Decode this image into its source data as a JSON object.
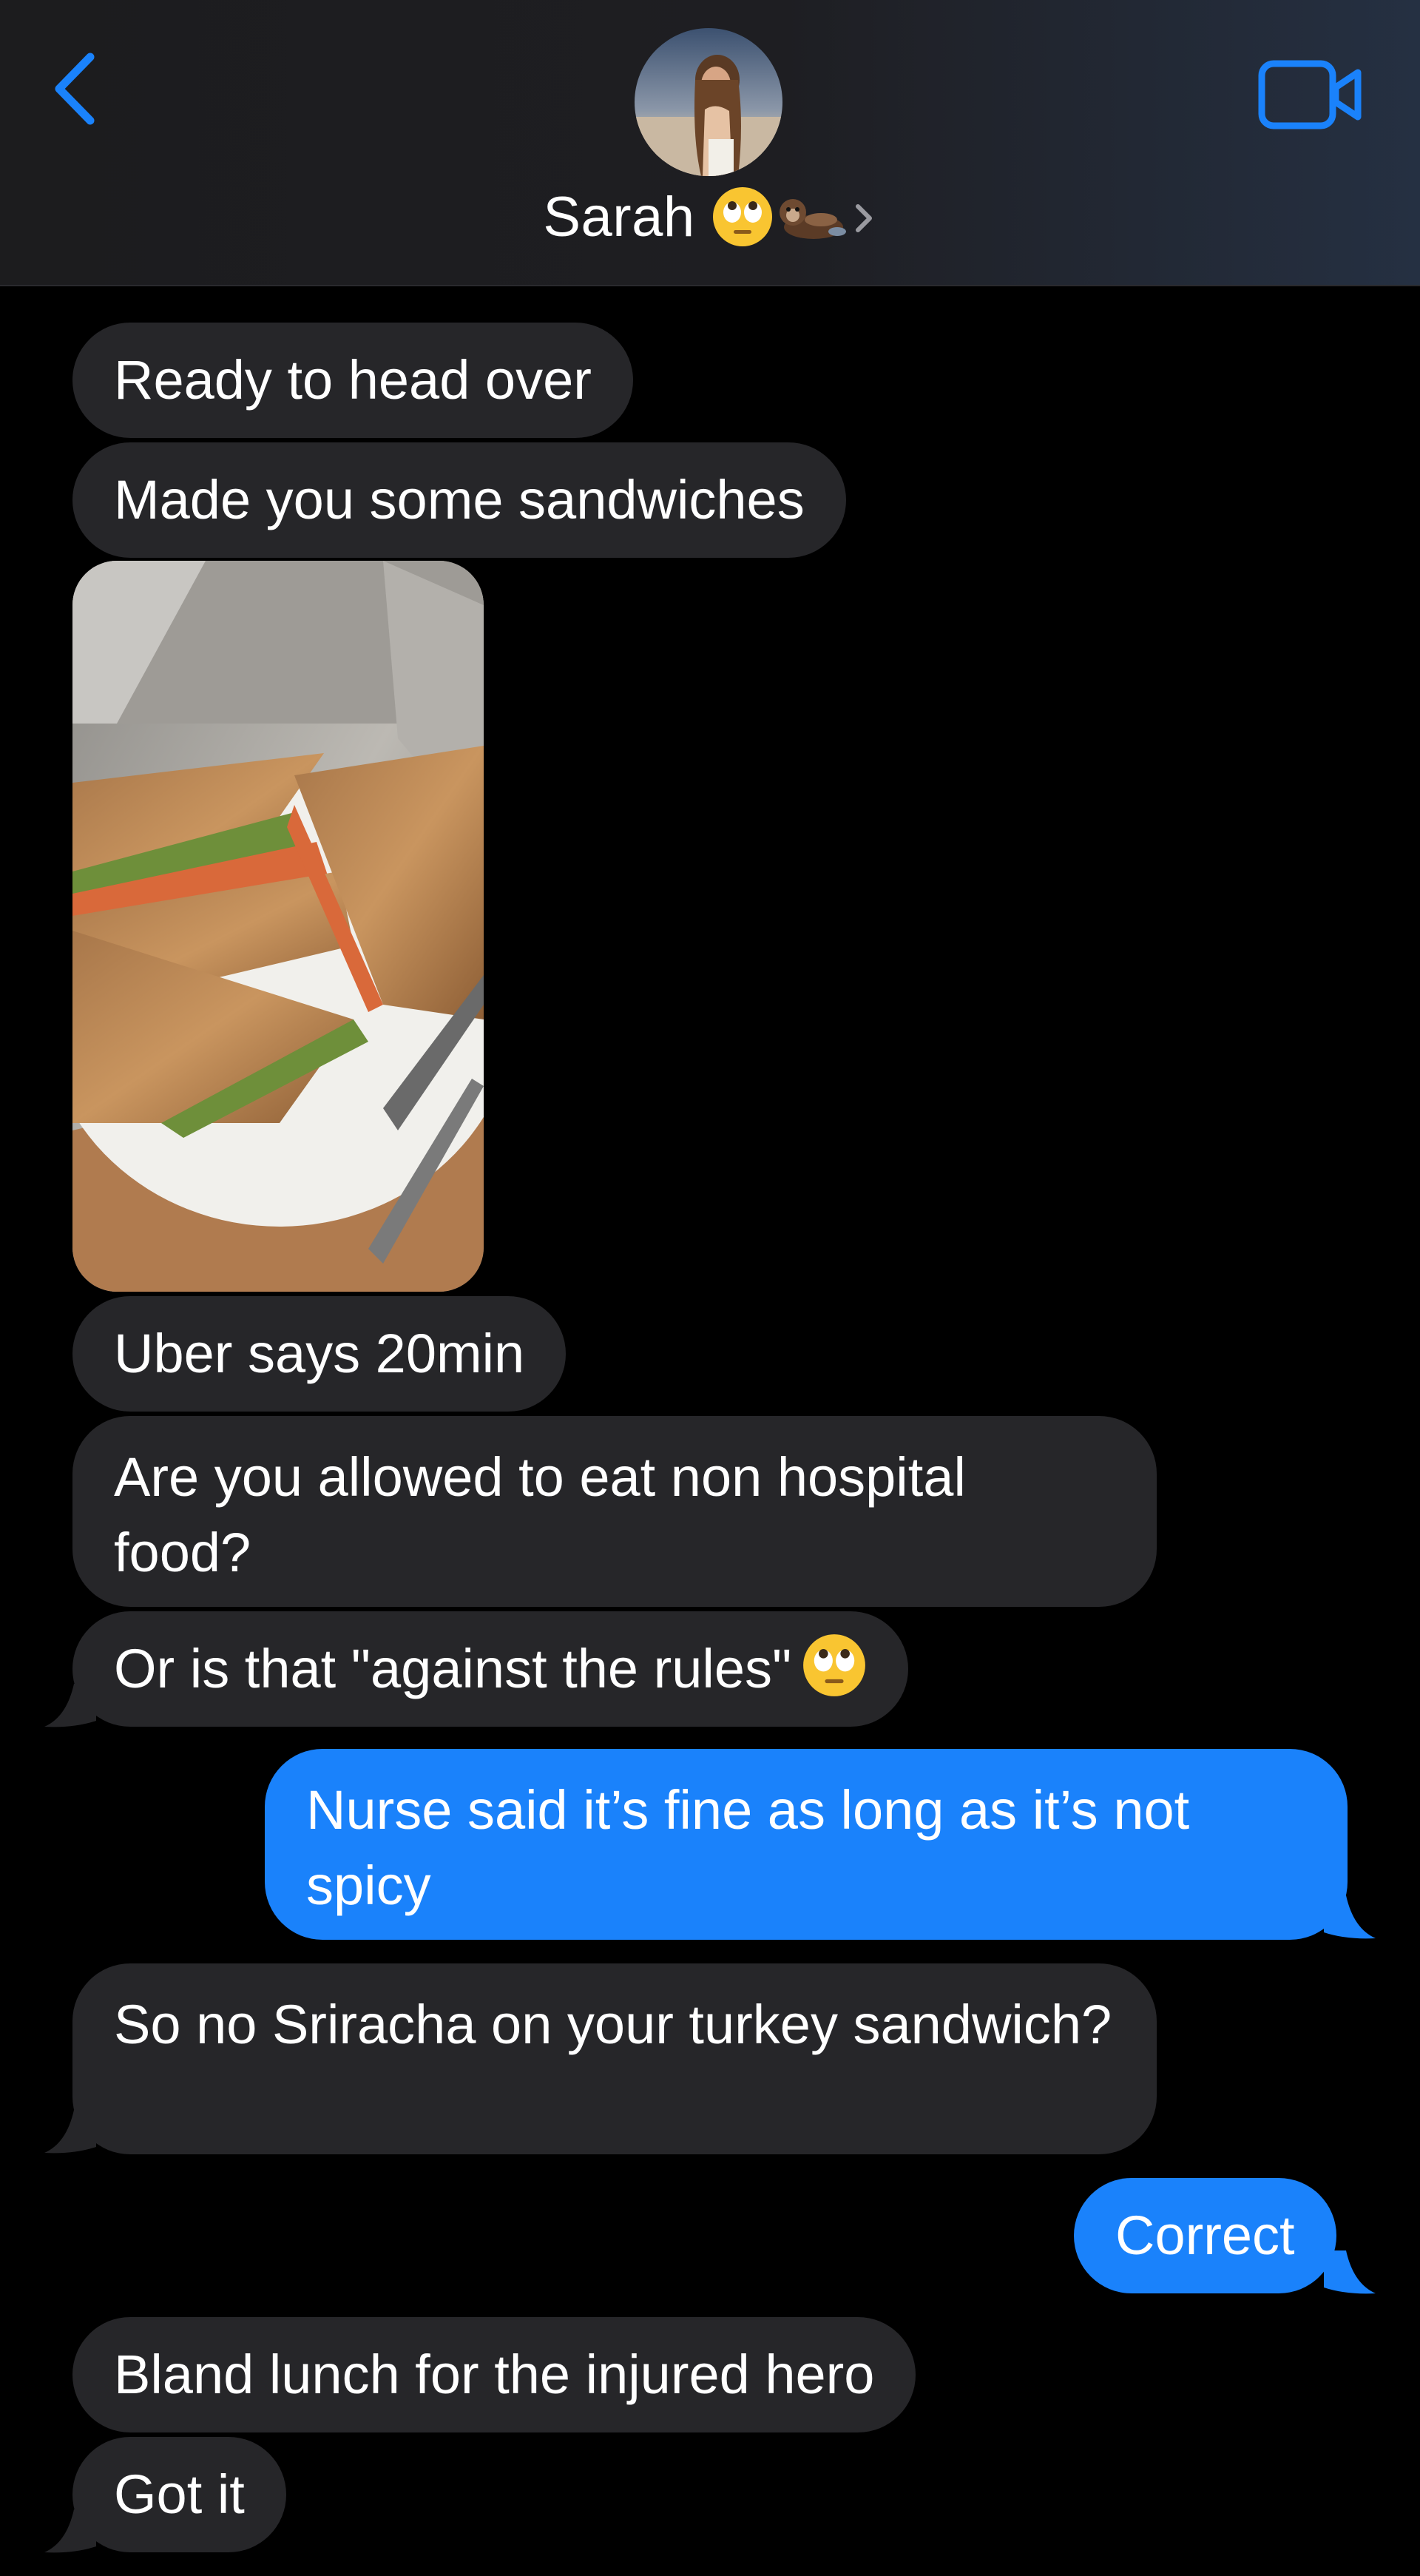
{
  "header": {
    "contact_name": "Sarah",
    "contact_emojis": [
      "face-with-rolling-eyes",
      "otter"
    ],
    "back_icon": "chevron-left-icon",
    "video_icon": "video-camera-icon",
    "accent_color": "#1a82fb"
  },
  "messages": [
    {
      "id": "m1",
      "direction": "incoming",
      "text": "Ready to head over"
    },
    {
      "id": "m2",
      "direction": "incoming",
      "text": "Made you some sandwiches"
    },
    {
      "id": "m3",
      "direction": "incoming",
      "type": "photo",
      "description_icon": "sandwich-photo"
    },
    {
      "id": "m4",
      "direction": "incoming",
      "text": "Uber says 20min"
    },
    {
      "id": "m5",
      "direction": "incoming",
      "text": "Are you allowed to eat non hospital food?"
    },
    {
      "id": "m6",
      "direction": "incoming",
      "text": "Or is that \"against the rules\"",
      "trailing_emoji": "face-with-rolling-eyes"
    },
    {
      "id": "m7",
      "direction": "outgoing",
      "text": "Nurse said it’s fine as long as it’s not spicy"
    },
    {
      "id": "m8",
      "direction": "incoming",
      "text": "So no Sriracha on your turkey sandwich?"
    },
    {
      "id": "m9",
      "direction": "outgoing",
      "text": "Correct"
    },
    {
      "id": "m10",
      "direction": "incoming",
      "text": "Bland lunch for the injured hero"
    },
    {
      "id": "m11",
      "direction": "incoming",
      "text": "Got it"
    }
  ],
  "colors": {
    "incoming_bubble": "#262629",
    "outgoing_bubble": "#1a82fb",
    "background": "#000000"
  }
}
